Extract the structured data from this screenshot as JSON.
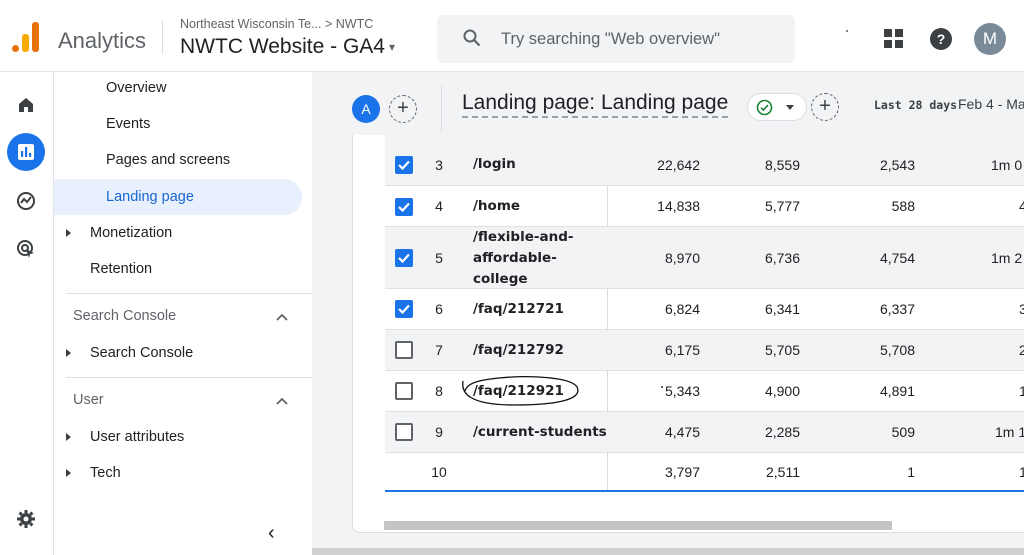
{
  "header": {
    "product": "Analytics",
    "breadcrumb": "Northeast Wisconsin Te... > NWTC",
    "property": "NWTC Website - GA4",
    "search_placeholder": "Try searching \"Web overview\"",
    "avatar_initial": "M",
    "help_glyph": "?"
  },
  "rail": {
    "icons": [
      "home-icon",
      "reports-icon",
      "explore-icon",
      "advertising-icon",
      "settings-icon"
    ],
    "active": "reports-icon",
    "accent": "#1a73e8"
  },
  "nav": {
    "items": [
      {
        "label": "Overview"
      },
      {
        "label": "Events"
      },
      {
        "label": "Pages and screens"
      },
      {
        "label": "Landing page",
        "active": true
      },
      {
        "label": "Monetization"
      },
      {
        "label": "Retention"
      }
    ],
    "search_console_header": "Search Console",
    "search_console_item": "Search Console",
    "user_header": "User",
    "user_items": [
      {
        "label": "User attributes"
      },
      {
        "label": "Tech"
      }
    ],
    "collapse_glyph": "‹"
  },
  "toolbar": {
    "segment_initial": "A",
    "add_glyph": "+",
    "title": "Landing page: Landing page",
    "range_label": "Last 28 days",
    "range_value": "Feb 4 - Ma"
  },
  "table": {
    "rows": [
      {
        "checked": true,
        "idx": "3",
        "page": "/login",
        "c1": "22,642",
        "c2": "8,559",
        "c3": "2,543",
        "c4": "1m 0"
      },
      {
        "checked": true,
        "idx": "4",
        "page": "/home",
        "c1": "14,838",
        "c2": "5,777",
        "c3": "588",
        "c4": "4"
      },
      {
        "checked": true,
        "idx": "5",
        "page": "/flexible-and-\naffordable-\ncollege",
        "c1": "8,970",
        "c2": "6,736",
        "c3": "4,754",
        "c4": "1m 2"
      },
      {
        "checked": true,
        "idx": "6",
        "page": "/faq/212721",
        "c1": "6,824",
        "c2": "6,341",
        "c3": "6,337",
        "c4": "3"
      },
      {
        "checked": false,
        "idx": "7",
        "page": "/faq/212792",
        "c1": "6,175",
        "c2": "5,705",
        "c3": "5,708",
        "c4": "2"
      },
      {
        "checked": false,
        "idx": "8",
        "page": "/faq/212921",
        "c1": "5,343",
        "c2": "4,900",
        "c3": "4,891",
        "c4": "1"
      },
      {
        "checked": false,
        "idx": "9",
        "page": "/current-students",
        "c1": "4,475",
        "c2": "2,285",
        "c3": "509",
        "c4": "1m 1"
      },
      {
        "checked": null,
        "idx": "10",
        "page": "",
        "c1": "3,797",
        "c2": "2,511",
        "c3": "1",
        "c4": "1"
      }
    ]
  }
}
